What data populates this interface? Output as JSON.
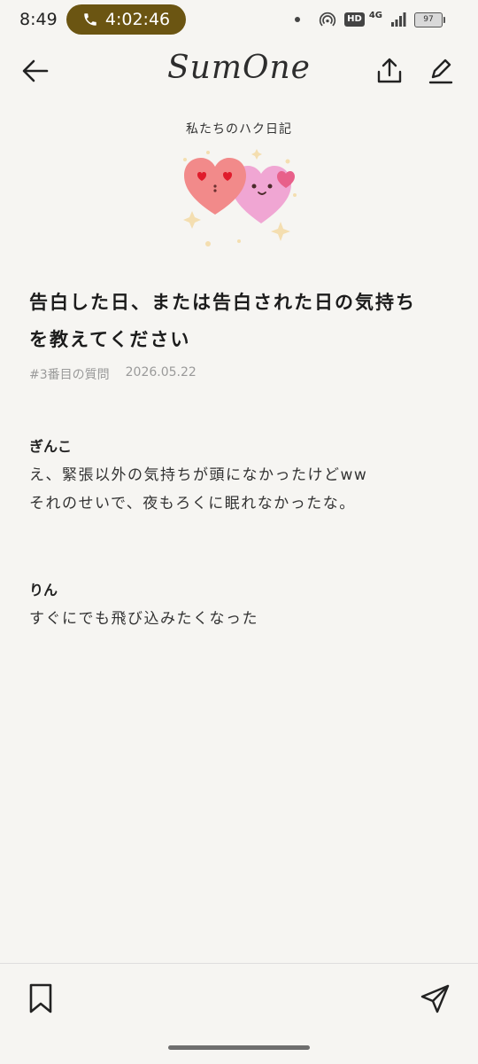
{
  "status_bar": {
    "time": "8:49",
    "call_duration": "4:02:46",
    "hd_label": "HD",
    "network_label": "4G",
    "battery_level": "97"
  },
  "nav": {
    "app_name": "SumOne",
    "icons": [
      "back-arrow-icon",
      "share-upload-icon",
      "edit-pen-icon"
    ]
  },
  "diary": {
    "title": "私たちのハク日記"
  },
  "question": {
    "text_line1": "告白した日、または告白された日の気持ち",
    "text_line2": "を教えてください",
    "number_label": "#3番目の質問",
    "date": "2026.05.22"
  },
  "answers": [
    {
      "name": "ぎんこ",
      "lines": [
        "え、緊張以外の気持ちが頭になかったけどww",
        "それのせいで、夜もろくに眠れなかったな。"
      ]
    },
    {
      "name": "りん",
      "lines": [
        "すぐにでも飛び込みたくなった"
      ]
    }
  ],
  "bottom_bar": {
    "icons": [
      "bookmark-icon",
      "send-icon"
    ]
  },
  "colors": {
    "background": "#f6f5f2",
    "call_pill": "#6b5512",
    "heart_left": "#f28a8a",
    "heart_right": "#f0a6d3"
  }
}
